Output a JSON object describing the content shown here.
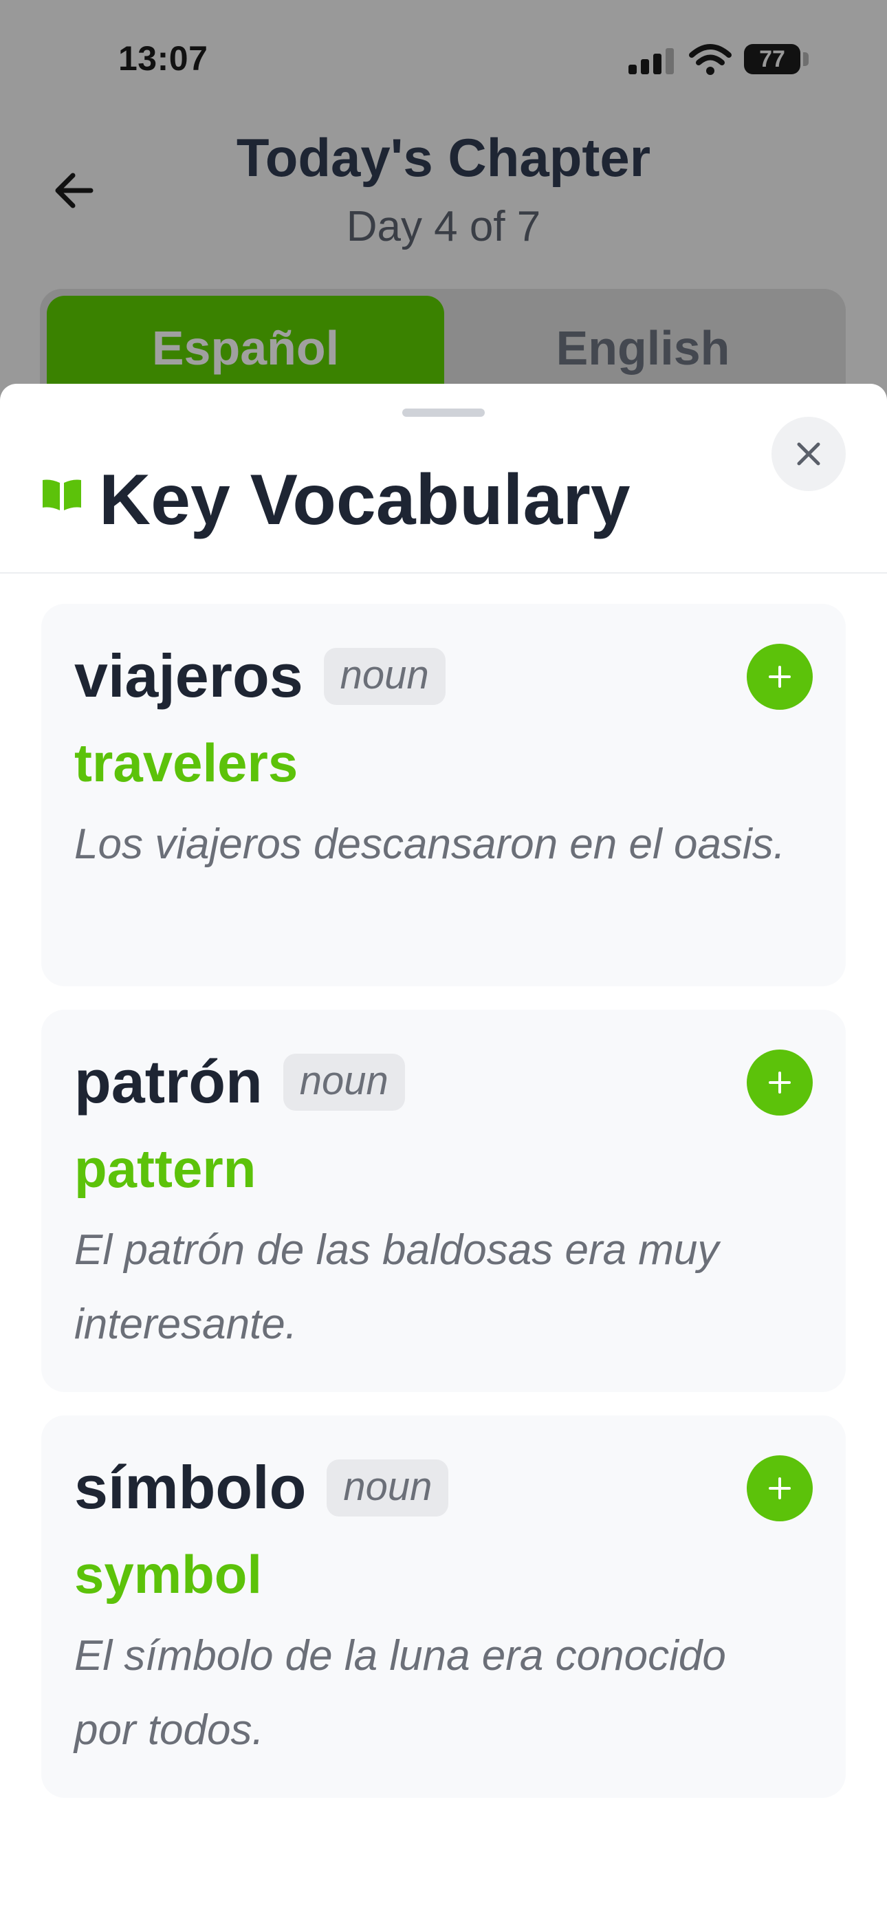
{
  "status_bar": {
    "time": "13:07",
    "battery": "77"
  },
  "header": {
    "title": "Today's Chapter",
    "subtitle": "Day 4 of 7"
  },
  "language_toggle": {
    "spanish_label": "Español",
    "english_label": "English"
  },
  "sheet": {
    "title": "Key Vocabulary"
  },
  "vocab": [
    {
      "word": "viajeros",
      "pos": "noun",
      "translation": "travelers",
      "example": "Los viajeros descansaron en el oasis."
    },
    {
      "word": "patrón",
      "pos": "noun",
      "translation": "pattern",
      "example": "El patrón de las baldosas era muy interesante."
    },
    {
      "word": "símbolo",
      "pos": "noun",
      "translation": "symbol",
      "example": "El símbolo de la luna era conocido por todos."
    }
  ],
  "colors": {
    "accent": "#5cc20a",
    "active_tab": "#3a8200",
    "text_dark": "#1e2533",
    "text_muted": "#6b6f78"
  },
  "icons": [
    "back-arrow-icon",
    "signal-icon",
    "wifi-icon",
    "battery-icon",
    "book-icon",
    "close-icon",
    "plus-icon"
  ]
}
